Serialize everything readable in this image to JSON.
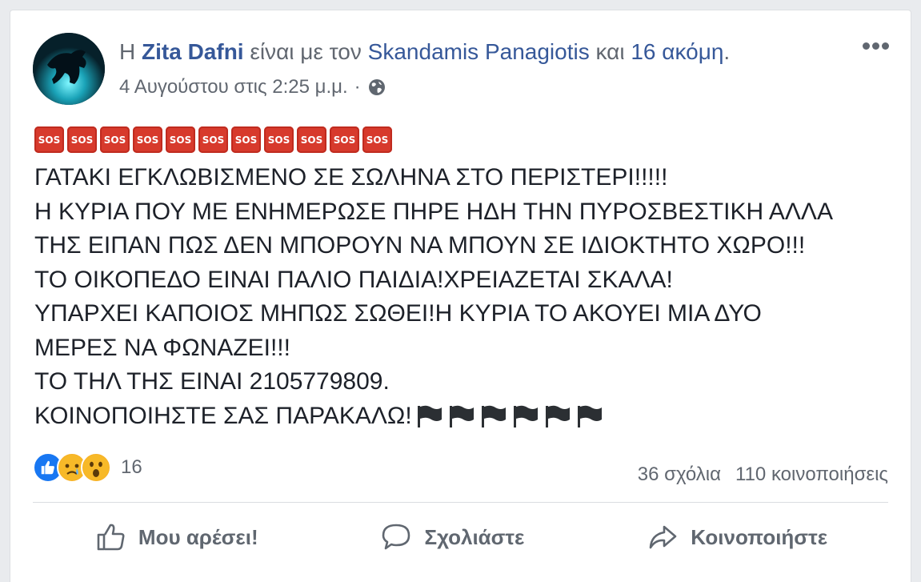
{
  "post": {
    "author_prefix": "Η",
    "author": "Zita Dafni",
    "with_text": "είναι με τον",
    "tagged": "Skandamis Panagiotis",
    "and_text": "και",
    "others": "16 ακόμη",
    "period": ".",
    "timestamp": "4 Αυγούστου στις 2:25 μ.μ.",
    "separator": "·",
    "privacy_icon": "globe-icon",
    "sos_label": "SOS",
    "sos_count": 11,
    "lines": [
      "ΓΑΤΑΚΙ ΕΓΚΛΩΒΙΣΜΕΝΟ ΣΕ ΣΩΛΗΝΑ ΣΤΟ ΠΕΡΙΣΤΕΡΙ!!!!!",
      "Η ΚΥΡΙΑ ΠΟΥ ΜΕ ΕΝΗΜΕΡΩΣΕ ΠΗΡΕ ΗΔΗ ΤΗΝ ΠΥΡΟΣΒΕΣΤΙΚΗ ΑΛΛΑ",
      "ΤΗΣ ΕΙΠΑΝ ΠΩΣ ΔΕΝ ΜΠΟΡΟΥΝ ΝΑ ΜΠΟΥΝ ΣΕ ΙΔΙΟΚΤΗΤΟ ΧΩΡΟ!!!",
      "ΤΟ ΟΙΚΟΠΕΔΟ ΕΙΝΑΙ ΠΑΛΙΟ ΠΑΙΔΙΑ!ΧΡΕΙΑΖΕΤΑΙ ΣΚΑΛΑ!",
      "ΥΠΑΡΧΕΙ ΚΑΠΟΙΟΣ ΜΗΠΩΣ ΣΩΘΕΙ!Η ΚΥΡΙΑ ΤΟ ΑΚΟΥΕΙ ΜΙΑ ΔΥΟ",
      "ΜΕΡΕΣ ΝΑ ΦΩΝΑΖΕΙ!!!",
      "ΤΟ ΤΗΛ ΤΗΣ ΕΙΝΑΙ 2105779809.",
      "ΚΟΙΝΟΠΟΙΗΣΤΕ ΣΑΣ ΠΑΡΑΚΑΛΩ!"
    ],
    "flag_count": 6
  },
  "reactions": {
    "icons": [
      "like-icon",
      "sad-icon",
      "wow-icon"
    ],
    "count": "16"
  },
  "stats": {
    "comments": "36 σχόλια",
    "shares": "110 κοινοποιήσεις"
  },
  "actions": {
    "like": "Μου αρέσει!",
    "comment": "Σχολιάστε",
    "share": "Κοινοποιήστε"
  },
  "colors": {
    "link": "#365899",
    "secondary_text": "#616770",
    "sos_red": "#d73a2c",
    "like_blue": "#1877f2"
  }
}
